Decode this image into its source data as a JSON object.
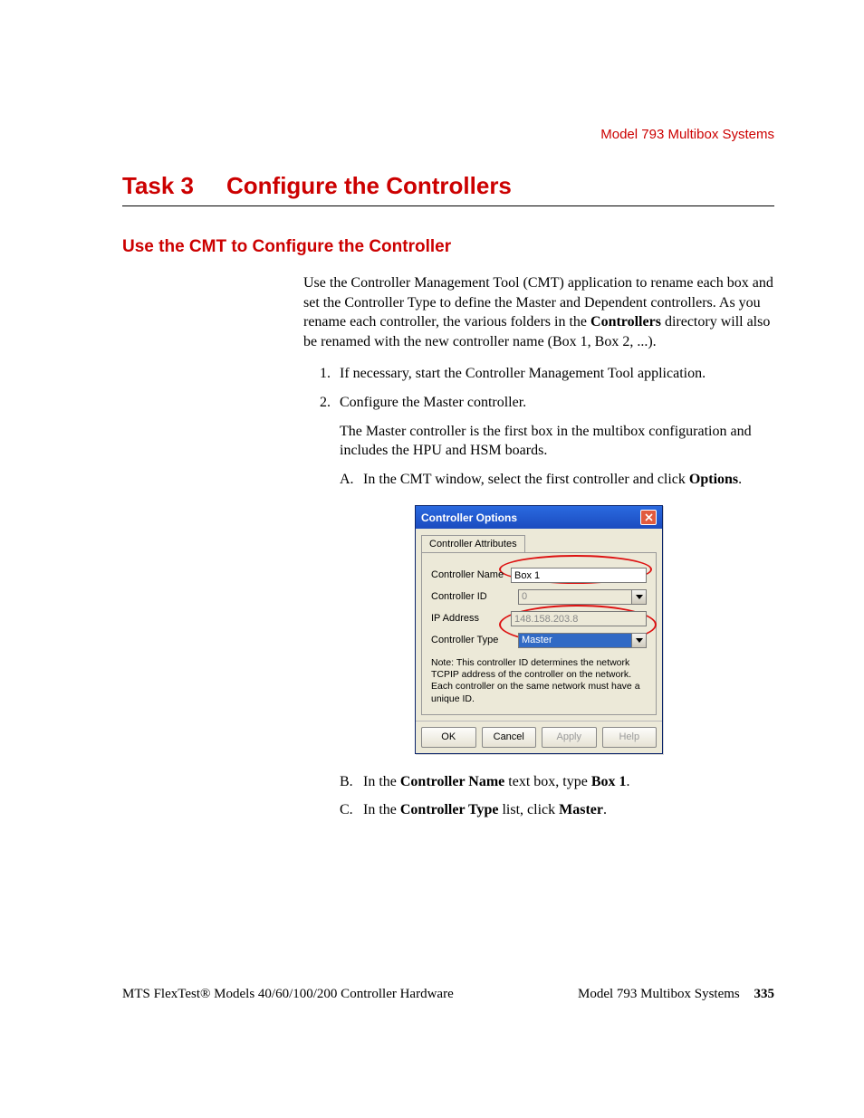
{
  "header": {
    "section": "Model 793 Multibox Systems"
  },
  "heading": {
    "task_label": "Task 3",
    "task_title": "Configure the Controllers"
  },
  "h2": "Use the CMT to Configure the Controller",
  "intro": {
    "p1_a": "Use the Controller Management Tool (CMT) application to rename each box and set the Controller Type to define the Master and Dependent controllers. As you rename each controller, the various folders in the ",
    "p1_bold": "Controllers",
    "p1_b": " directory will also be renamed with the new controller name (Box 1, Box 2, ...)."
  },
  "steps": {
    "s1": {
      "num": "1.",
      "text": "If necessary, start the Controller Management Tool application."
    },
    "s2": {
      "num": "2.",
      "text": "Configure the Master controller.",
      "sub_para": "The Master controller is the first box in the multibox configuration and includes the HPU and HSM boards.",
      "a": {
        "letter": "A.",
        "pre": "In the CMT window, select the first controller and click ",
        "bold": "Options",
        "post": "."
      },
      "b": {
        "letter": "B.",
        "pre": "In the ",
        "bold1": "Controller Name",
        "mid": " text box, type ",
        "bold2": "Box 1",
        "post": "."
      },
      "c": {
        "letter": "C.",
        "pre": "In the ",
        "bold1": "Controller Type",
        "mid": " list, click ",
        "bold2": "Master",
        "post": "."
      }
    }
  },
  "dialog": {
    "title": "Controller Options",
    "tab": "Controller Attributes",
    "rows": {
      "name": {
        "label": "Controller Name",
        "value": "Box 1"
      },
      "id": {
        "label": "Controller ID",
        "value": "0"
      },
      "ip": {
        "label": "IP Address",
        "value": "148.158.203.8"
      },
      "type": {
        "label": "Controller Type",
        "value": "Master"
      }
    },
    "note": "Note: This controller ID determines the network TCPIP address of the controller on the network. Each controller on the same network must have a unique ID.",
    "buttons": {
      "ok": "OK",
      "cancel": "Cancel",
      "apply": "Apply",
      "help": "Help"
    }
  },
  "footer": {
    "left": "MTS FlexTest® Models 40/60/100/200 Controller Hardware",
    "right_label": "Model 793 Multibox Systems",
    "page": "335"
  }
}
